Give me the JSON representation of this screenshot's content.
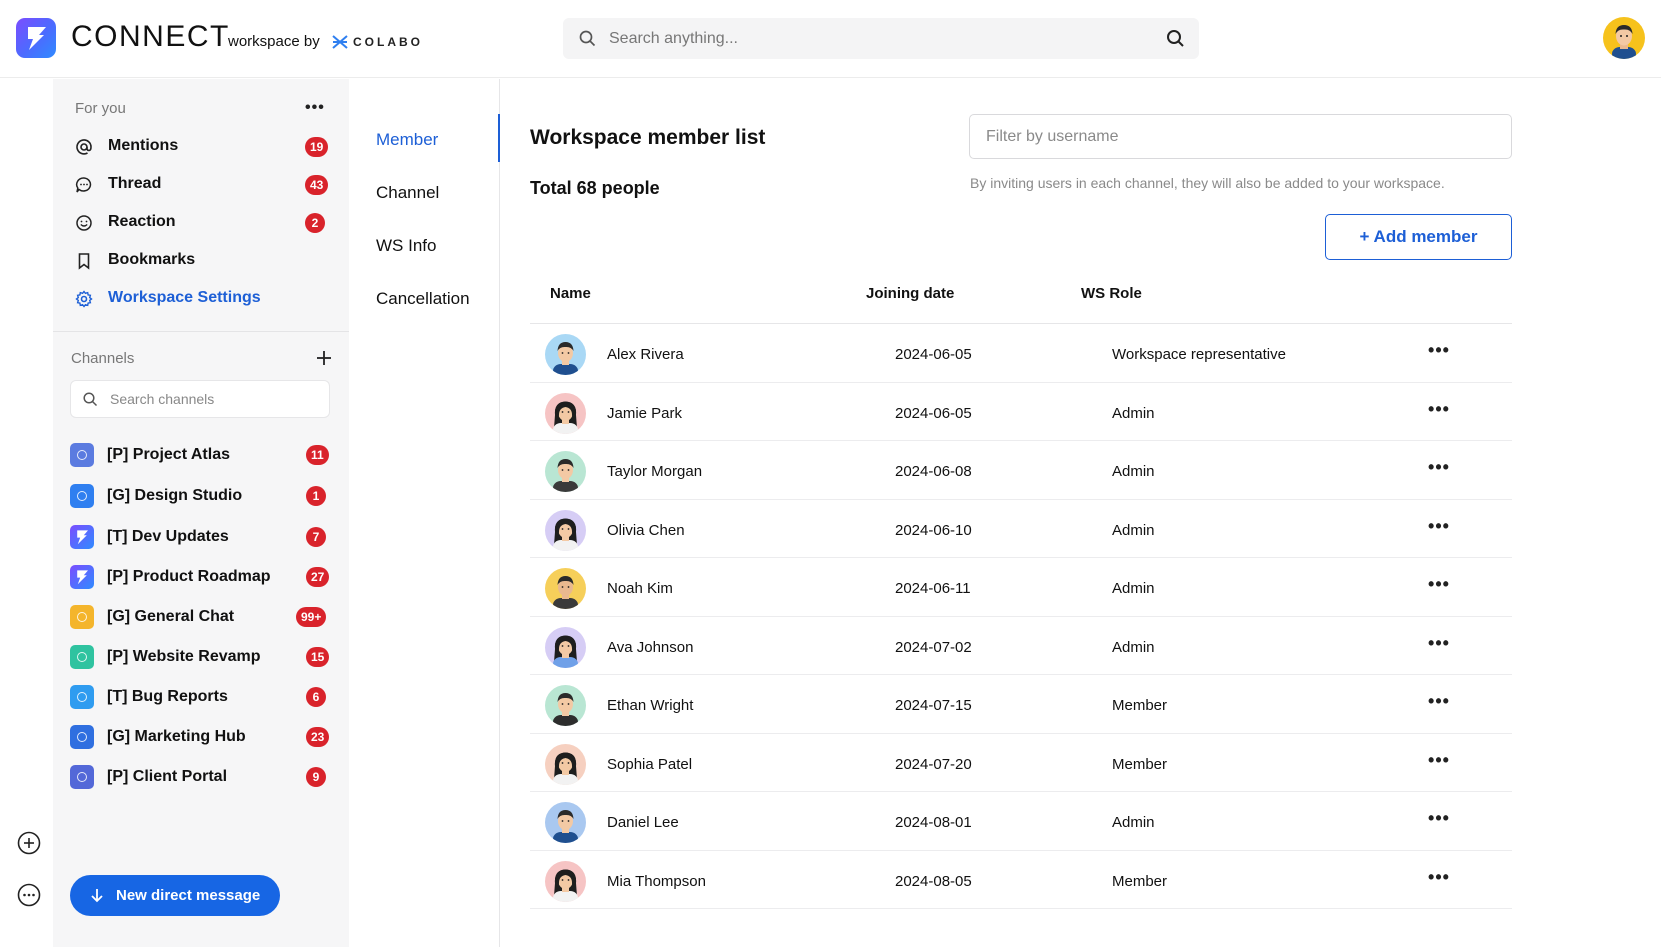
{
  "header": {
    "brand": "CONNECT",
    "brand_by": "workspace by",
    "partner": "COLABO",
    "search_placeholder": "Search anything..."
  },
  "sidebar": {
    "for_you_title": "For you",
    "nav": [
      {
        "label": "Mentions",
        "icon": "at-icon",
        "badge": "19"
      },
      {
        "label": "Thread",
        "icon": "chat-bubble-icon",
        "badge": "43"
      },
      {
        "label": "Reaction",
        "icon": "smiley-icon",
        "badge": "2"
      },
      {
        "label": "Bookmarks",
        "icon": "bookmark-icon",
        "badge": ""
      },
      {
        "label": "Workspace Settings",
        "icon": "gear-icon",
        "badge": ""
      }
    ],
    "channels_title": "Channels",
    "channel_search_placeholder": "Search channels",
    "channels": [
      {
        "label": "[P] Project Atlas",
        "badge": "11",
        "color": "#5b7be0"
      },
      {
        "label": "[G] Design Studio",
        "badge": "1",
        "color": "#2f7ff0"
      },
      {
        "label": "[T] Dev Updates",
        "badge": "7",
        "color": "#6a5cf0"
      },
      {
        "label": "[P] Product Roadmap",
        "badge": "27",
        "color": "#6a5cf0"
      },
      {
        "label": "[G] General Chat",
        "badge": "99+",
        "color": "#f4b52c"
      },
      {
        "label": "[P] Website Revamp",
        "badge": "15",
        "color": "#2fc3a0"
      },
      {
        "label": "[T] Bug Reports",
        "badge": "6",
        "color": "#2f9cf0"
      },
      {
        "label": "[G] Marketing Hub",
        "badge": "23",
        "color": "#2f6fe0"
      },
      {
        "label": "[P] Client Portal",
        "badge": "9",
        "color": "#5368d8"
      }
    ],
    "dm_button": "New direct message"
  },
  "settings_nav": [
    "Member",
    "Channel",
    "WS Info",
    "Cancellation"
  ],
  "main": {
    "title": "Workspace member list",
    "total": "Total 68 people",
    "filter_placeholder": "Filter by username",
    "hint": "By inviting users in each channel, they will also be added to your workspace.",
    "add_button": "+ Add member",
    "columns": [
      "Name",
      "Joining date",
      "WS Role"
    ],
    "members": [
      {
        "name": "Alex Rivera",
        "date": "2024-06-05",
        "role": "Workspace representative",
        "bg": "#a9d8f5",
        "skin": "#f3c9a4",
        "hair": "#2a2a2a",
        "shirt": "#1f4f8f",
        "female": false
      },
      {
        "name": "Jamie Park",
        "date": "2024-06-05",
        "role": "Admin",
        "bg": "#f6c4c4",
        "skin": "#f3c9a4",
        "hair": "#1e1e1e",
        "shirt": "#f2f2f2",
        "female": true
      },
      {
        "name": "Taylor Morgan",
        "date": "2024-06-08",
        "role": "Admin",
        "bg": "#b9e6d3",
        "skin": "#f3c9a4",
        "hair": "#2a2a2a",
        "shirt": "#3a3a3a",
        "female": false
      },
      {
        "name": "Olivia Chen",
        "date": "2024-06-10",
        "role": "Admin",
        "bg": "#d6cdf5",
        "skin": "#f3c9a4",
        "hair": "#1e1e1e",
        "shirt": "#f2f2f2",
        "female": true
      },
      {
        "name": "Noah Kim",
        "date": "2024-06-11",
        "role": "Admin",
        "bg": "#f6cf5a",
        "skin": "#e9b88f",
        "hair": "#2a2a2a",
        "shirt": "#3a3a3a",
        "female": false
      },
      {
        "name": "Ava Johnson",
        "date": "2024-07-02",
        "role": "Admin",
        "bg": "#d6cdf5",
        "skin": "#f3c9a4",
        "hair": "#1e1e1e",
        "shirt": "#6fa0e8",
        "female": true
      },
      {
        "name": "Ethan Wright",
        "date": "2024-07-15",
        "role": "Member",
        "bg": "#b9e6d3",
        "skin": "#f3c9a4",
        "hair": "#2a2a2a",
        "shirt": "#2d2d2d",
        "female": false
      },
      {
        "name": "Sophia Patel",
        "date": "2024-07-20",
        "role": "Member",
        "bg": "#f6d0c0",
        "skin": "#f3c9a4",
        "hair": "#1e1e1e",
        "shirt": "#f2f2f2",
        "female": true
      },
      {
        "name": "Daniel Lee",
        "date": "2024-08-01",
        "role": "Admin",
        "bg": "#a9c8f0",
        "skin": "#f3c9a4",
        "hair": "#2a2a2a",
        "shirt": "#1f4f8f",
        "female": false
      },
      {
        "name": "Mia Thompson",
        "date": "2024-08-05",
        "role": "Member",
        "bg": "#f6c4c4",
        "skin": "#f3c9a4",
        "hair": "#1e1e1e",
        "shirt": "#f2f2f2",
        "female": true
      }
    ],
    "row_action": "•••"
  },
  "colors": {
    "accent": "#1d5fd6",
    "badge": "#d9232b",
    "dm_button": "#1766e4",
    "current_user_bg": "#f6c21c"
  }
}
